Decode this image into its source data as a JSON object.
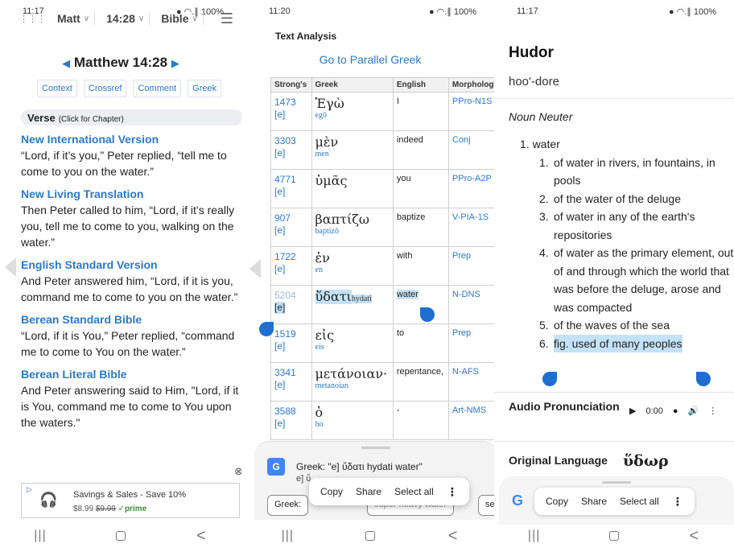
{
  "panel1": {
    "status": {
      "time": "11:17",
      "icons_left": "🛈 ✦ 📷 ⁕",
      "icons_right": "● ◠.∥ 100%"
    },
    "topbar": {
      "book": "Matt",
      "chapter_verse": "14:28",
      "mode": "Bible"
    },
    "verse_ref": "Matthew 14:28",
    "tabs": [
      "Context",
      "Crossref",
      "Comment",
      "Greek"
    ],
    "verse_label": "Verse",
    "verse_hint": "(Click for Chapter)",
    "versions": [
      {
        "name": "New International Version",
        "text": "“Lord, if it’s you,” Peter replied, “tell me to come to you on the water.”"
      },
      {
        "name": "New Living Translation",
        "text": "Then Peter called to him, “Lord, if it’s really you, tell me to come to you, walking on the water.”"
      },
      {
        "name": "English Standard Version",
        "text": "And Peter answered him, “Lord, if it is you, command me to come to you on the water.”"
      },
      {
        "name": "Berean Standard Bible",
        "text": "“Lord, if it is You,” Peter replied, “command me to come to You on the water.”"
      },
      {
        "name": "Berean Literal Bible",
        "text": "And Peter answering said to Him, \"Lord, if it is You, command me to come to You upon the waters.\""
      }
    ],
    "ad": {
      "text": "Savings & Sales - Save 10%",
      "price": "$8.99",
      "old_price": "$9.99",
      "prime": "✓prime"
    }
  },
  "panel2": {
    "status": {
      "time": "11:20",
      "icons_right": "● ◠.∥ 100%"
    },
    "heading": "Text Analysis",
    "parallel_link": "Go to Parallel Greek",
    "columns": [
      "Strong's",
      "Greek",
      "English",
      "Morphology"
    ],
    "rows": [
      {
        "num": "1473",
        "e": "[e]",
        "greek": "Ἐγὼ",
        "translit": "egō",
        "english": "I",
        "morph": "PPro-N1S"
      },
      {
        "num": "3303",
        "e": "[e]",
        "greek": "μὲν",
        "translit": "men",
        "english": "indeed",
        "morph": "Conj"
      },
      {
        "num": "4771",
        "e": "[e]",
        "greek": "ὑμᾶς",
        "translit": "",
        "english": "you",
        "morph": "PPro-A2P"
      },
      {
        "num": "907",
        "e": "[e]",
        "greek": "βαπτίζω",
        "translit": "baptizō",
        "english": "baptize",
        "morph": "V-PIA-1S"
      },
      {
        "num": "1722",
        "e": "[e]",
        "greek": "ἐν",
        "translit": "en",
        "english": "with",
        "morph": "Prep"
      },
      {
        "num": "5204",
        "e": "[e]",
        "greek": "ὕδατι",
        "translit": "hydati",
        "english": "water",
        "morph": "N-DNS"
      },
      {
        "num": "1519",
        "e": "[e]",
        "greek": "εἰς",
        "translit": "eis",
        "english": "to",
        "morph": "Prep"
      },
      {
        "num": "3341",
        "e": "[e]",
        "greek": "μετάνοιαν·",
        "translit": "metanoian",
        "english": "repentance,",
        "morph": "N-AFS"
      },
      {
        "num": "3588",
        "e": "[e]",
        "greek": "ὁ",
        "translit": "ho",
        "english": "-",
        "morph": "Art-NMS"
      }
    ],
    "translate_text": "Greek: \"e] ὕδατι hydati water\"",
    "translate_sub": "e] ὕ",
    "sheet_buttons": [
      "Greek: ",
      "super heavy water",
      "ser"
    ],
    "popup": [
      "Copy",
      "Share",
      "Select all"
    ],
    "more": "⋮"
  },
  "panel3": {
    "status": {
      "time": "11:17",
      "icons_right": "● ◠.∥ 100%"
    },
    "word": "Hudor",
    "pronunciation": "hoo'-dore",
    "part_of_speech": "Noun Neuter",
    "main_def": "1. water",
    "subdefs": [
      {
        "n": "1.",
        "t": "of water in rivers, in fountains, in pools"
      },
      {
        "n": "2.",
        "t": "of the water of the deluge"
      },
      {
        "n": "3.",
        "t": "of water in any of the earth's repositories"
      },
      {
        "n": "4.",
        "t": "of water as the primary element, out of and through which the world that was before the deluge, arose and was compacted"
      },
      {
        "n": "5.",
        "t": "of the waves of the sea"
      },
      {
        "n": "6.",
        "t": "fig. used of many peoples"
      }
    ],
    "audio_label": "Audio Pronunciation",
    "audio_time": "0:00",
    "original_label": "Original Language",
    "original_word": "ὕδωρ",
    "popup": [
      "Copy",
      "Share",
      "Select all"
    ],
    "more": "⋮",
    "google": "G"
  },
  "colors": {
    "link_blue": "#2a7ac9",
    "highlight": "#c4e2f7",
    "handle": "#1f6fd1"
  },
  "nav": {
    "recent": "|||",
    "back": "<"
  }
}
